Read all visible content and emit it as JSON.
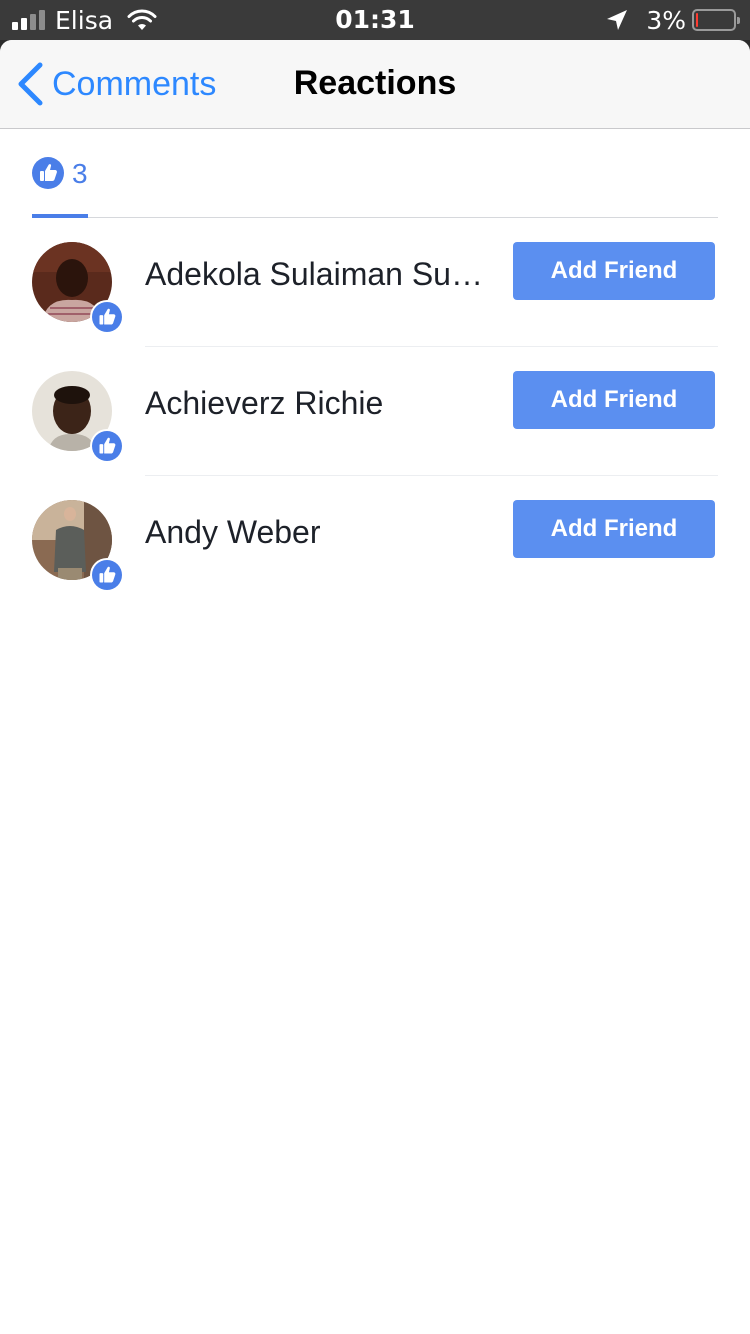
{
  "status_bar": {
    "carrier": "Elisa",
    "time": "01:31",
    "battery_percent_label": "3%",
    "battery_level": 0.03,
    "signal_bars": 4,
    "signal_bars_active": 2,
    "icons": [
      "signal-icon",
      "wifi-icon",
      "location-arrow-icon",
      "battery-icon"
    ]
  },
  "nav": {
    "back_label": "Comments",
    "title": "Reactions"
  },
  "tabs": {
    "like_count": "3",
    "icon": "like-icon"
  },
  "people": [
    {
      "name": "Adekola Sulaiman Sulaimon",
      "button": "Add Friend",
      "reaction": "like"
    },
    {
      "name": "Achieverz Richie",
      "button": "Add Friend",
      "reaction": "like"
    },
    {
      "name": "Andy Weber",
      "button": "Add Friend",
      "reaction": "like"
    }
  ],
  "colors": {
    "accent": "#4a7ee8",
    "button": "#5b8ff0",
    "link": "#2d88ff",
    "status_bar": "#3a3a3a"
  }
}
